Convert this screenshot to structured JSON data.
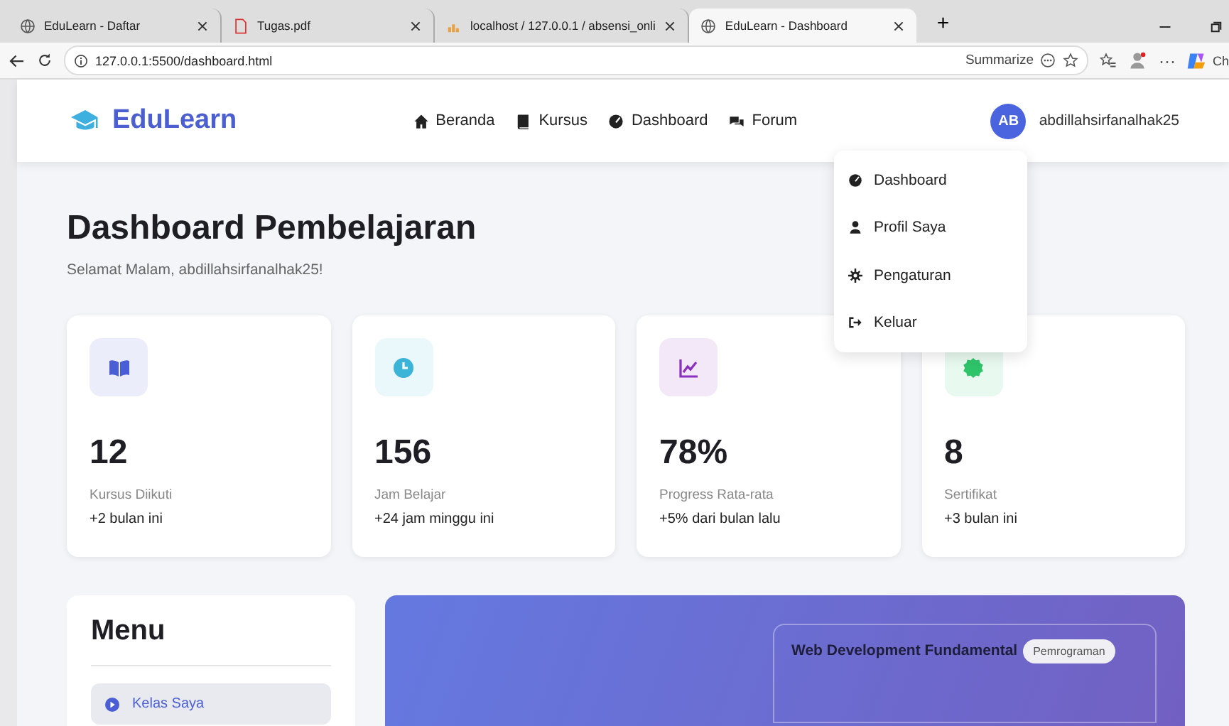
{
  "browser": {
    "tabs": [
      {
        "title": "EduLearn - Daftar",
        "kind": "globe",
        "selected": false
      },
      {
        "title": "Tugas.pdf",
        "kind": "pdf",
        "selected": false
      },
      {
        "title": "localhost / 127.0.0.1 / absensi_onli",
        "kind": "db",
        "selected": false
      },
      {
        "title": "EduLearn - Dashboard",
        "kind": "globe",
        "selected": true
      }
    ],
    "new_tab": "+",
    "url": "127.0.0.1:5500/dashboard.html",
    "summarize": "Summarize",
    "more": "···",
    "copilot": "Ch"
  },
  "navbar": {
    "brand": "EduLearn",
    "links": [
      {
        "label": "Beranda",
        "kind": "home"
      },
      {
        "label": "Kursus",
        "kind": "book"
      },
      {
        "label": "Dashboard",
        "kind": "gauge"
      },
      {
        "label": "Forum",
        "kind": "chat"
      }
    ],
    "avatar": "AB",
    "username": "abdillahsirfanalhak25"
  },
  "dropdown": [
    {
      "label": "Dashboard",
      "kind": "gauge"
    },
    {
      "label": "Profil Saya",
      "kind": "user"
    },
    {
      "label": "Pengaturan",
      "kind": "gear"
    },
    {
      "label": "Keluar",
      "kind": "logout"
    }
  ],
  "heading": "Dashboard Pembelajaran",
  "greeting": "Selamat Malam, abdillahsirfanalhak25!",
  "stats": [
    {
      "value": "12",
      "label": "Kursus Diikuti",
      "change": "+2 bulan ini",
      "kind": "book",
      "color": "#4a5fd6"
    },
    {
      "value": "156",
      "label": "Jam Belajar",
      "change": "+24 jam minggu ini",
      "kind": "clock",
      "color": "#3cb4d8"
    },
    {
      "value": "78%",
      "label": "Progress Rata-rata",
      "change": "+5% dari bulan lalu",
      "kind": "chart",
      "color": "#8a2fc0"
    },
    {
      "value": "8",
      "label": "Sertifikat",
      "change": "+3 bulan ini",
      "kind": "badge",
      "color": "#2fc46a"
    }
  ],
  "menu": {
    "title": "Menu",
    "items": [
      {
        "label": "Kelas Saya",
        "selected": true
      }
    ]
  },
  "course": {
    "title": "Web Development Fundamental",
    "tag": "Pemrograman"
  }
}
